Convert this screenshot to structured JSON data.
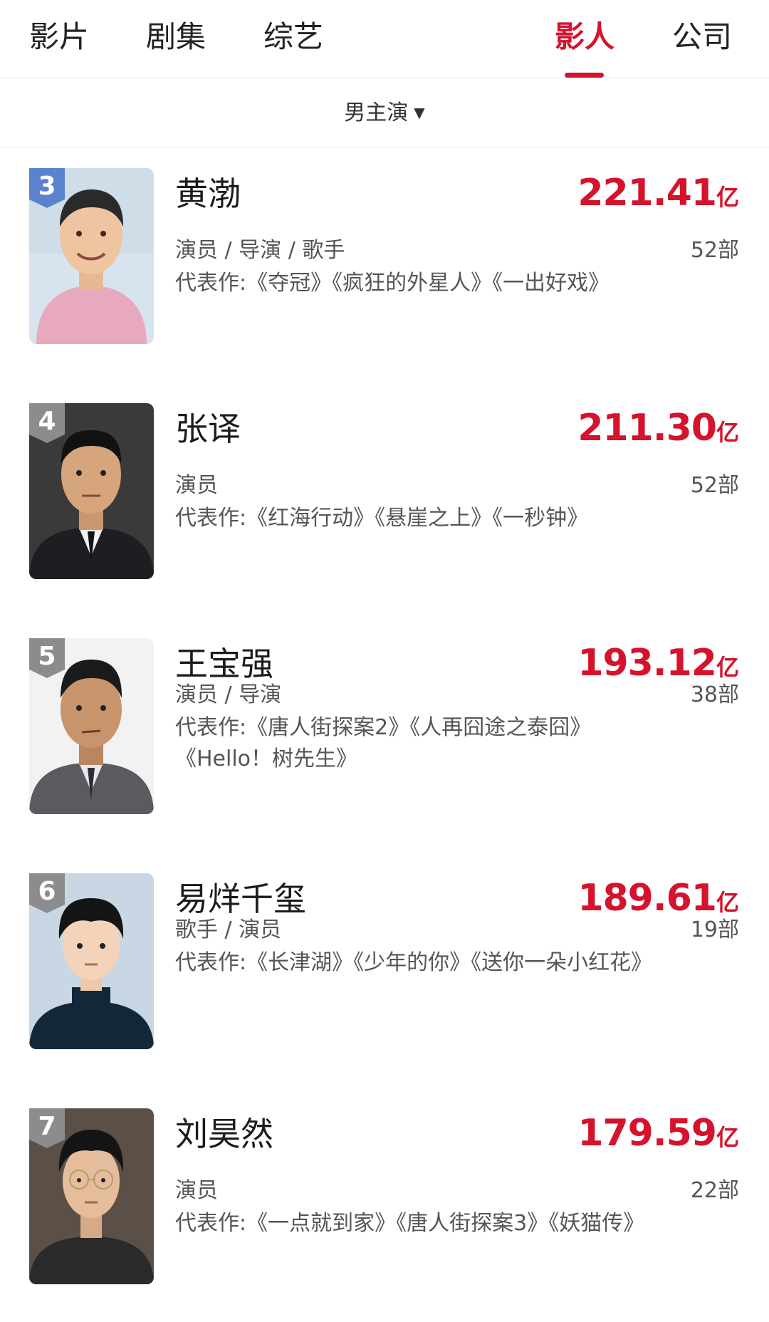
{
  "tabs": [
    {
      "label": "影片"
    },
    {
      "label": "剧集"
    },
    {
      "label": "综艺"
    },
    {
      "label": "影人"
    },
    {
      "label": "公司"
    }
  ],
  "active_tab": "影人",
  "filter": {
    "label": "男主演",
    "caret": "▼"
  },
  "list": [
    {
      "rank": "3",
      "name": "黄渤",
      "box_value": "221.41",
      "box_unit": "亿",
      "roles": "演员 / 导演 / 歌手",
      "count": "52部",
      "works": "代表作:《夺冠》《疯狂的外星人》《一出好戏》",
      "rank_badge_color": "#5b82cf"
    },
    {
      "rank": "4",
      "name": "张译",
      "box_value": "211.30",
      "box_unit": "亿",
      "roles": "演员",
      "count": "52部",
      "works": "代表作:《红海行动》《悬崖之上》《一秒钟》",
      "rank_badge_color": "#8c8c8c"
    },
    {
      "rank": "5",
      "name": "王宝强",
      "box_value": "193.12",
      "box_unit": "亿",
      "roles": "演员 / 导演",
      "count": "38部",
      "works": "代表作:《唐人街探案2》《人再囧途之泰囧》《Hello！树先生》",
      "rank_badge_color": "#8c8c8c"
    },
    {
      "rank": "6",
      "name": "易烊千玺",
      "box_value": "189.61",
      "box_unit": "亿",
      "roles": "歌手 / 演员",
      "count": "19部",
      "works": "代表作:《长津湖》《少年的你》《送你一朵小红花》",
      "rank_badge_color": "#8c8c8c"
    },
    {
      "rank": "7",
      "name": "刘昊然",
      "box_value": "179.59",
      "box_unit": "亿",
      "roles": "演员",
      "count": "22部",
      "works": "代表作:《一点就到家》《唐人街探案3》《妖猫传》",
      "rank_badge_color": "#8c8c8c"
    }
  ],
  "colors": {
    "accent": "#d5132d"
  }
}
